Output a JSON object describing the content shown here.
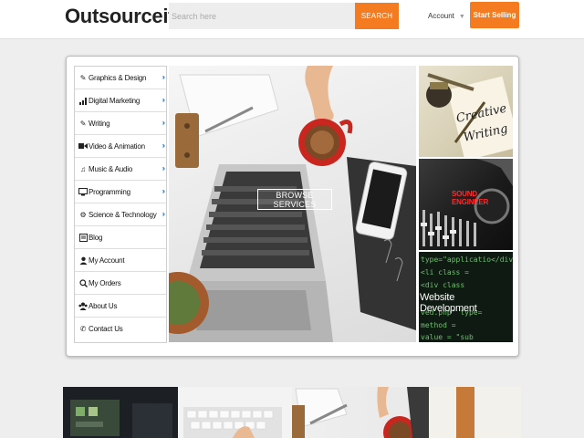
{
  "header": {
    "logo": "Outsourceit",
    "search_placeholder": "Search here",
    "search_button": "SEARCH",
    "account": "Account",
    "start_selling": "Start Selling"
  },
  "sidebar": {
    "items": [
      {
        "label": "Graphics & Design",
        "icon": "pencil-square-icon",
        "has_submenu": true
      },
      {
        "label": "Digital Marketing",
        "icon": "bar-chart-icon",
        "has_submenu": true
      },
      {
        "label": "Writing",
        "icon": "pencil-square-icon",
        "has_submenu": true
      },
      {
        "label": "Video & Animation",
        "icon": "video-camera-icon",
        "has_submenu": true
      },
      {
        "label": "Music & Audio",
        "icon": "music-icon",
        "has_submenu": true
      },
      {
        "label": "Programming",
        "icon": "monitor-icon",
        "has_submenu": true
      },
      {
        "label": "Science & Technology",
        "icon": "gear-icon",
        "has_submenu": true
      },
      {
        "label": "Blog",
        "icon": "blog-icon",
        "has_submenu": false
      },
      {
        "label": "My Account",
        "icon": "user-icon",
        "has_submenu": false
      },
      {
        "label": "My Orders",
        "icon": "search-icon",
        "has_submenu": false
      },
      {
        "label": "About Us",
        "icon": "group-icon",
        "has_submenu": false
      },
      {
        "label": "Contact Us",
        "icon": "phone-icon",
        "has_submenu": false
      }
    ]
  },
  "hero": {
    "browse_button": "BROWSE SERVICES"
  },
  "tiles": {
    "creative_writing_line1": "Creative",
    "creative_writing_line2": "Writing",
    "sound_engineer": "SOUND ENGINEER",
    "website_development": "Website Development",
    "code_lines": [
      "type=\"applicatio</div>",
      "  <li class = ",
      "    <div class",
      "ved.php\" type=",
      "       method =",
      "  value = \"sub"
    ]
  },
  "colors": {
    "accent": "#f47b20",
    "chevron": "#3a8fd6"
  }
}
